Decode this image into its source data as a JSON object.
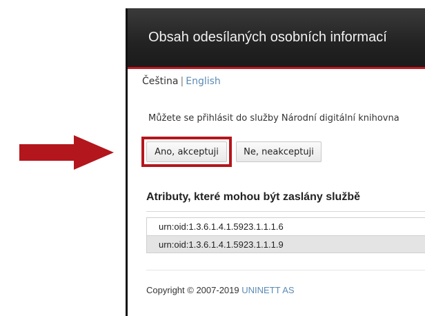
{
  "header": {
    "title": "Obsah odesílaných osobních informací"
  },
  "language": {
    "current": "Čeština",
    "separator": "|",
    "other": "English"
  },
  "intro_text": "Můžete se přihlásit do služby Národní digitální knihovna",
  "buttons": {
    "accept_label": "Ano, akceptuji",
    "decline_label": "Ne, neakceptuji"
  },
  "attributes": {
    "title": "Atributy, které mohou být zaslány službě",
    "items": [
      "urn:oid:1.3.6.1.4.1.5923.1.1.1.6",
      "urn:oid:1.3.6.1.4.1.5923.1.1.1.9"
    ]
  },
  "footer": {
    "text": "Copyright © 2007-2019",
    "link": "UNINETT AS"
  },
  "colors": {
    "accent_red": "#b3161c",
    "header_dark": "#262626",
    "link_blue": "#5a8ab5"
  },
  "annotation": {
    "arrow_icon": "red-arrow-right-icon"
  }
}
